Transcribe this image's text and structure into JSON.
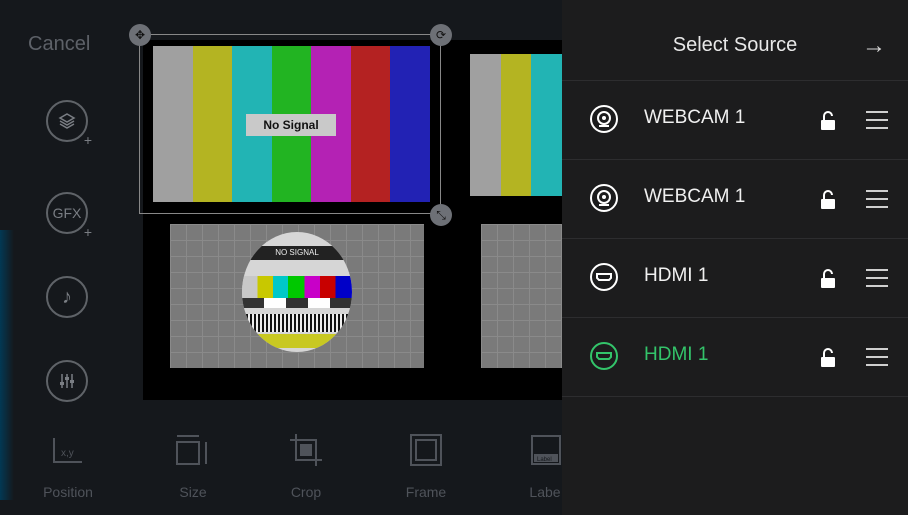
{
  "left": {
    "cancel_label": "Cancel",
    "tools": [
      {
        "name": "layers-add-icon",
        "label": ""
      },
      {
        "name": "gfx-add-icon",
        "label": "GFX"
      },
      {
        "name": "music-note-icon",
        "label": "♪"
      },
      {
        "name": "mixer-icon",
        "label": ""
      }
    ],
    "no_signal": "No Signal",
    "test_card_text": "NO SIGNAL",
    "bottom_toolbar": [
      {
        "label": "Position",
        "icon": "position-icon",
        "badge": "x,y"
      },
      {
        "label": "Size",
        "icon": "size-icon"
      },
      {
        "label": "Crop",
        "icon": "crop-icon"
      },
      {
        "label": "Frame",
        "icon": "frame-icon"
      },
      {
        "label": "Labe",
        "icon": "label-icon",
        "badge": "Label"
      }
    ]
  },
  "panel": {
    "title": "Select Source",
    "close_icon": "arrow-right-icon",
    "sources": [
      {
        "label": "WEBCAM 1",
        "icon": "webcam-icon",
        "active": false
      },
      {
        "label": "WEBCAM 1",
        "icon": "webcam-icon",
        "active": false
      },
      {
        "label": "HDMI 1",
        "icon": "hdmi-icon",
        "active": false
      },
      {
        "label": "HDMI 1",
        "icon": "hdmi-icon",
        "active": true
      }
    ]
  },
  "colors": {
    "accent": "#33c46a",
    "panel_bg": "#1c1c1d",
    "color_bars": [
      "#a0a0a0",
      "#b4b422",
      "#22b4b4",
      "#22b422",
      "#b422b4",
      "#b42222",
      "#2222b4"
    ]
  }
}
